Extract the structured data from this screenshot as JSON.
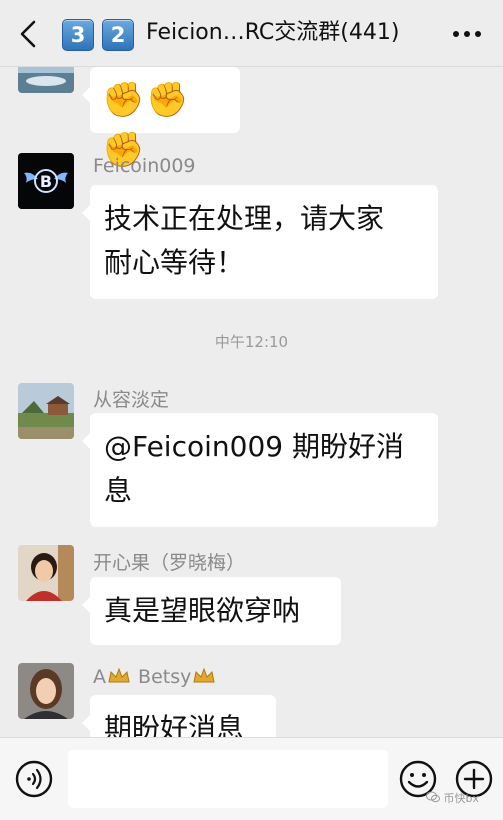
{
  "header": {
    "badge_1": "3",
    "badge_2": "2",
    "title": "Feicion…RC交流群(441)"
  },
  "messages": [
    {
      "sender": "",
      "text": "✊✊✊",
      "avatar": "landscape-avatar"
    },
    {
      "sender": "Feicoin009",
      "lines": [
        "技术正在处理，请大家",
        "耐心等待！"
      ],
      "avatar": "bitcoin-wings-logo"
    },
    {
      "sender": "从容淡定",
      "lines": [
        "@Feicoin009  期盼好消",
        "息"
      ],
      "avatar": "temple-landscape-avatar"
    },
    {
      "sender": "开心果（罗晓梅）",
      "text": "真是望眼欲穿呐",
      "avatar": "woman-portrait-avatar"
    },
    {
      "sender_prefix": "A",
      "sender_suffix": " Betsy",
      "text": "期盼好消息",
      "avatar": "woman-portrait-avatar"
    }
  ],
  "timestamp": "中午12:10",
  "input": {
    "value": ""
  },
  "watermark": "币快bx",
  "colors": {
    "background": "#ededed",
    "bubble": "#ffffff",
    "badge": "#3b82c4",
    "muted_text": "#8a8a8a"
  }
}
